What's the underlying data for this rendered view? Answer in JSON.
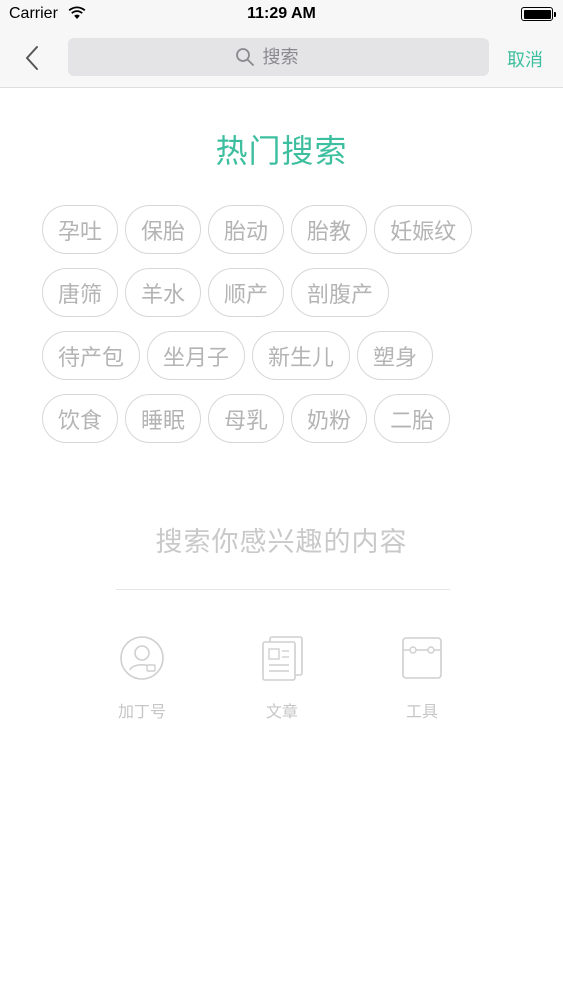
{
  "status_bar": {
    "carrier": "Carrier",
    "time": "11:29 AM"
  },
  "nav": {
    "search_placeholder": "搜索",
    "cancel_label": "取消"
  },
  "hot_search": {
    "title": "热门搜索",
    "rows": [
      [
        "孕吐",
        "保胎",
        "胎动",
        "胎教",
        "妊娠纹"
      ],
      [
        "唐筛",
        "羊水",
        "顺产",
        "剖腹产"
      ],
      [
        "待产包",
        "坐月子",
        "新生儿",
        "塑身"
      ],
      [
        "饮食",
        "睡眠",
        "母乳",
        "奶粉",
        "二胎"
      ]
    ]
  },
  "hint": "搜索你感兴趣的内容",
  "categories": [
    {
      "label": "加丁号",
      "icon": "account-icon"
    },
    {
      "label": "文章",
      "icon": "article-icon"
    },
    {
      "label": "工具",
      "icon": "tool-icon"
    }
  ],
  "colors": {
    "accent": "#3dbf9f",
    "tag_text": "#b4b4b4",
    "tag_border": "#d7d7d7",
    "hint_text": "#c9c9c9"
  }
}
